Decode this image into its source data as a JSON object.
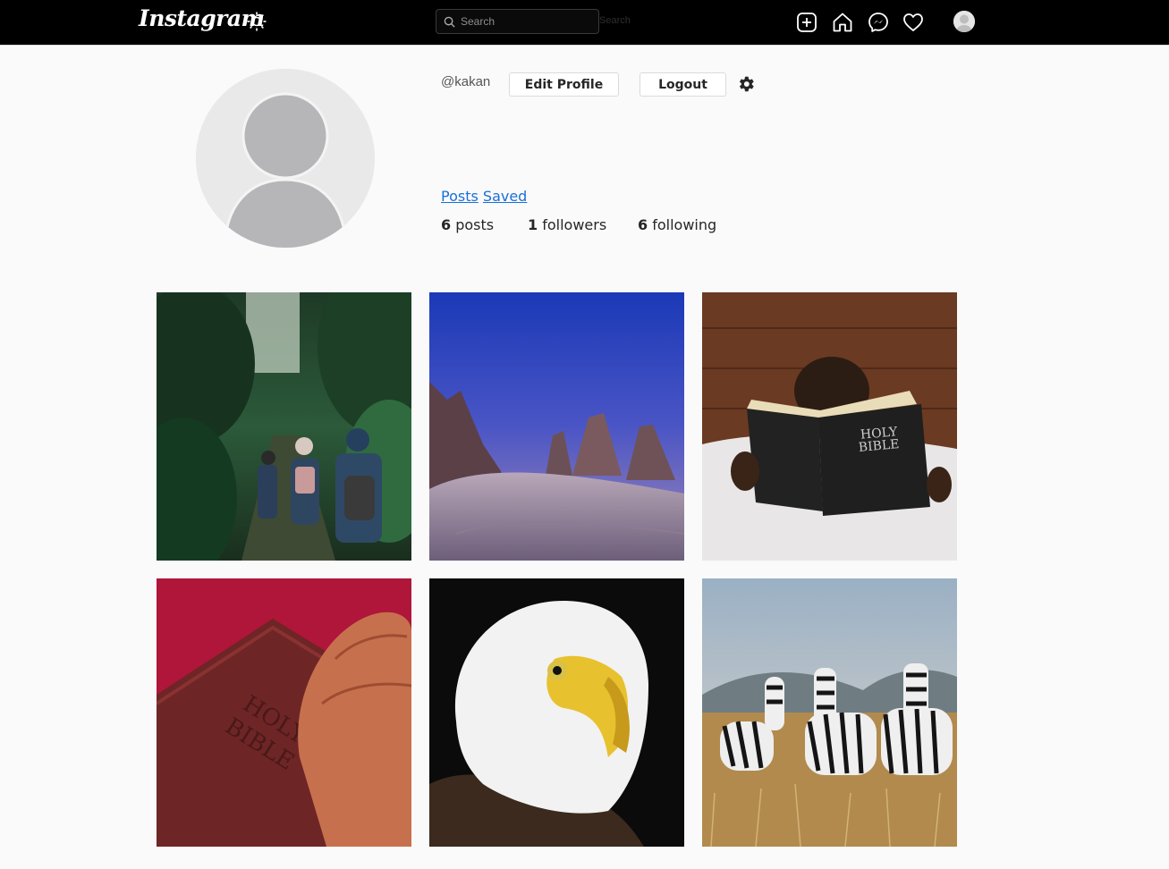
{
  "header": {
    "logo": "Instagram",
    "search_placeholder": "Search",
    "search_ghost": "Search"
  },
  "profile": {
    "username": "@kakan",
    "edit_label": "Edit Profile",
    "logout_label": "Logout",
    "tabs": {
      "posts": "Posts",
      "saved": "Saved"
    },
    "stats": {
      "posts_count": "6",
      "posts_label": "posts",
      "followers_count": "1",
      "followers_label": "followers",
      "following_count": "6",
      "following_label": "following"
    }
  },
  "posts": [
    {
      "subject": "hikers on forest trail"
    },
    {
      "subject": "mountain peaks at dusk"
    },
    {
      "subject": "child reading bible",
      "book_text_1": "HOLY",
      "book_text_2": "BIBLE"
    },
    {
      "subject": "hands on bible",
      "book_text_1": "HOLY",
      "book_text_2": "BIBLE"
    },
    {
      "subject": "bald eagle portrait"
    },
    {
      "subject": "zebras in grassland"
    }
  ],
  "colors": {
    "topbar": "#000000",
    "background": "#fafafa",
    "link": "#1a6fd8"
  }
}
